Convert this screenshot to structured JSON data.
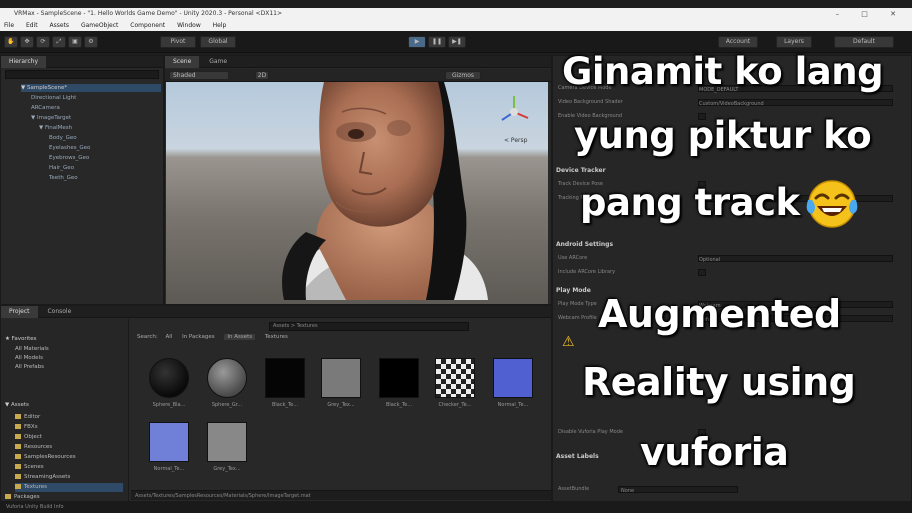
{
  "window": {
    "title": "VRMax - SampleScene - \"1. Hello Worlds Game Demo\" - Unity 2020.3 - Personal <DX11>",
    "controls": "– □ ✕"
  },
  "menu": [
    "File",
    "Edit",
    "Assets",
    "GameObject",
    "Component",
    "Window",
    "Help"
  ],
  "toolbar": {
    "left_buttons": [
      "✋",
      "✥",
      "⟳",
      "⤢",
      "▣",
      "⚙"
    ],
    "pivot_label": "Pivot",
    "global_label": "Global",
    "play_icon": "▶",
    "pause_icon": "❚❚",
    "step_icon": "▶❚",
    "account_label": "Account",
    "layers_label": "Layers",
    "layout_label": "Default"
  },
  "hierarchy": {
    "tab": "Hierarchy",
    "items": [
      "▼ SampleScene*",
      "  Directional Light",
      "  ARCamera",
      "  ▼ ImageTarget",
      "    ▼ FinalMesh",
      "      Body_Geo",
      "      Eyelashes_Geo",
      "      Eyebrows_Geo",
      "      Hair_Geo",
      "      Teeth_Geo"
    ]
  },
  "scene_view": {
    "tabs": [
      "Scene",
      "Game"
    ],
    "shading_mode": "Shaded",
    "mode_2d": "2D",
    "gizmos": "Gizmos",
    "persp_label": "< Persp"
  },
  "project": {
    "tabs": [
      "Project",
      "Console"
    ],
    "favorites_label": "★ Favorites",
    "favorites": [
      "All Materials",
      "All Models",
      "All Prefabs"
    ],
    "assets_label": "▼ Assets",
    "folders": [
      "Editor",
      "FBXs",
      "Object",
      "Resources",
      "SamplesResources",
      "Scenes",
      "StreamingAssets",
      "Textures",
      "Packages"
    ],
    "search_tabs": [
      "Search:",
      "All",
      "In Packages",
      "In Assets",
      "Textures"
    ],
    "breadcrumb": "Assets > Textures",
    "assets": [
      {
        "label": "Sphere_Bla...",
        "color": "#1a1a1a"
      },
      {
        "label": "Sphere_Gr...",
        "color": "#6a6a6a"
      },
      {
        "label": "Black_Te...",
        "color": "#050505"
      },
      {
        "label": "Grey_Tex...",
        "color": "#7a7a7a"
      },
      {
        "label": "Black_Te...",
        "color": "#000000"
      },
      {
        "label": "Checker_Te...",
        "color": "#999999"
      },
      {
        "label": "Normal_Te...",
        "color": "#5060d0"
      },
      {
        "label": "Normal_Te...",
        "color": "#7080d8"
      },
      {
        "label": "Grey_Tex...",
        "color": "#888888"
      }
    ],
    "path_bar": "Assets/Textures/SamplesResources/Materials/Sphere/ImageTarget.mat"
  },
  "inspector": {
    "section_device": "Device Tracker",
    "section_android": "Android Settings",
    "section_play": "Play Mode",
    "section_labels": "Asset Labels",
    "asset_bundle": "AssetBundle",
    "asset_bundle_value": "None",
    "warning_icon": "⚠",
    "rows": [
      "Camera Device Mode",
      "Video Background Shader",
      "Enable Video Background",
      "Track Device Pose",
      "Tracking Mode",
      "Use ARCore",
      "Include ARCore Library",
      "Play Mode Type",
      "Webcam Profile",
      "Disable Vuforia Play Mode"
    ],
    "field_values": [
      "MODE_DEFAULT",
      "Custom/VideoBackground",
      "",
      "",
      "POSITIONAL",
      "Optional",
      "",
      "Webcam",
      "Default",
      ""
    ]
  },
  "overlay": {
    "line1": "Ginamit ko lang",
    "line2": "yung piktur ko",
    "line3": "pang track",
    "emoji": "😂",
    "line4": "Augmented",
    "line5": "Reality using",
    "line6": "vuforia"
  },
  "status": "Vuforia Unity Build Info",
  "colors": {
    "editor_bg": "#1e1e1e",
    "panel_bg": "#282828",
    "overlay_text": "#ffffff",
    "emoji_face": "#f5c21b"
  }
}
